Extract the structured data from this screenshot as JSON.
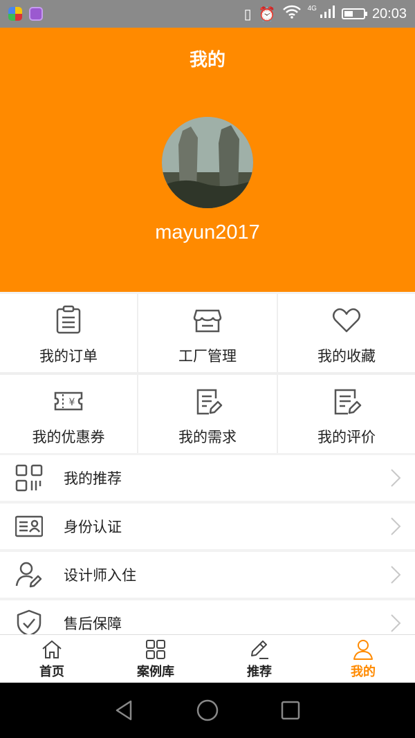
{
  "status_bar": {
    "time": "20:03",
    "network": "4G"
  },
  "header": {
    "title": "我的",
    "username": "mayun2017"
  },
  "grid": [
    {
      "label": "我的订单",
      "icon": "clipboard-icon"
    },
    {
      "label": "工厂管理",
      "icon": "store-icon"
    },
    {
      "label": "我的收藏",
      "icon": "heart-icon"
    },
    {
      "label": "我的优惠券",
      "icon": "coupon-icon"
    },
    {
      "label": "我的需求",
      "icon": "note-edit-icon"
    },
    {
      "label": "我的评价",
      "icon": "review-edit-icon"
    }
  ],
  "list": [
    {
      "label": "我的推荐",
      "icon": "qrcode-icon"
    },
    {
      "label": "身份认证",
      "icon": "id-card-icon"
    },
    {
      "label": "设计师入住",
      "icon": "user-edit-icon"
    },
    {
      "label": "售后保障",
      "icon": "shield-check-icon"
    }
  ],
  "bottom_nav": [
    {
      "label": "首页",
      "icon": "home-icon"
    },
    {
      "label": "案例库",
      "icon": "grid-icon"
    },
    {
      "label": "推荐",
      "icon": "pencil-icon"
    },
    {
      "label": "我的",
      "icon": "user-icon",
      "active": true
    }
  ],
  "colors": {
    "accent": "#ff8a00",
    "icon_gray": "#555555"
  }
}
